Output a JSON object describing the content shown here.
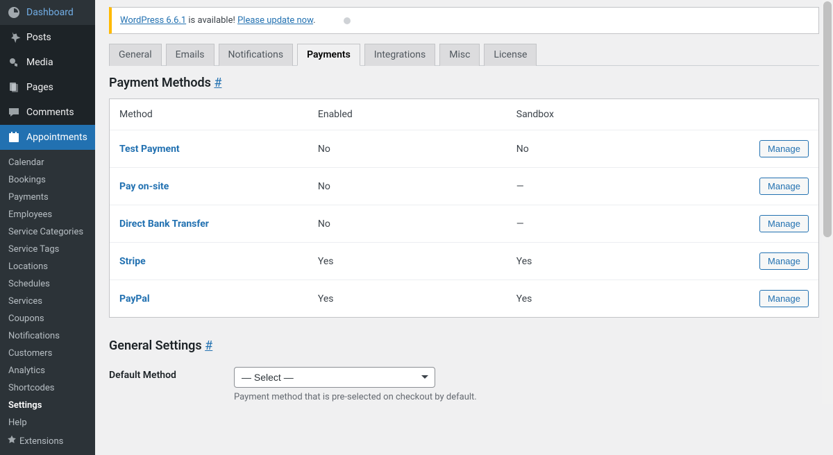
{
  "sidebar": {
    "items": [
      {
        "label": "Dashboard",
        "icon": "dashboard"
      },
      {
        "label": "Posts",
        "icon": "pin"
      },
      {
        "label": "Media",
        "icon": "media"
      },
      {
        "label": "Pages",
        "icon": "pages"
      },
      {
        "label": "Comments",
        "icon": "comment"
      },
      {
        "label": "Appointments",
        "icon": "calendar",
        "active": true
      }
    ],
    "submenu": [
      "Calendar",
      "Bookings",
      "Payments",
      "Employees",
      "Service Categories",
      "Service Tags",
      "Locations",
      "Schedules",
      "Services",
      "Coupons",
      "Notifications",
      "Customers",
      "Analytics",
      "Shortcodes",
      "Settings",
      "Help",
      "Extensions"
    ],
    "submenu_current": "Settings"
  },
  "notice": {
    "link1": "WordPress 6.6.1",
    "text": " is available! ",
    "link2": "Please update now",
    "tail": "."
  },
  "tabs": [
    "General",
    "Emails",
    "Notifications",
    "Payments",
    "Integrations",
    "Misc",
    "License"
  ],
  "tab_active": "Payments",
  "section1": {
    "title": "Payment Methods ",
    "hash": "#",
    "columns": [
      "Method",
      "Enabled",
      "Sandbox",
      ""
    ],
    "rows": [
      {
        "method": "Test Payment",
        "enabled": "No",
        "sandbox": "No",
        "manage": "Manage"
      },
      {
        "method": "Pay on-site",
        "enabled": "No",
        "sandbox": "—",
        "manage": "Manage"
      },
      {
        "method": "Direct Bank Transfer",
        "enabled": "No",
        "sandbox": "—",
        "manage": "Manage"
      },
      {
        "method": "Stripe",
        "enabled": "Yes",
        "sandbox": "Yes",
        "manage": "Manage"
      },
      {
        "method": "PayPal",
        "enabled": "Yes",
        "sandbox": "Yes",
        "manage": "Manage"
      }
    ]
  },
  "section2": {
    "title": "General Settings ",
    "hash": "#",
    "default_method_label": "Default Method",
    "default_method_placeholder": "— Select —",
    "default_method_description": "Payment method that is pre-selected on checkout by default."
  }
}
